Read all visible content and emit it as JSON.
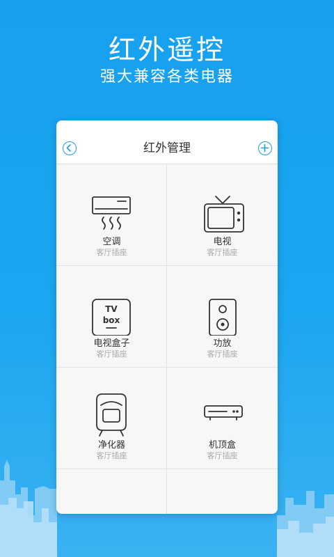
{
  "hero": {
    "title": "红外遥控",
    "subtitle": "强大兼容各类电器"
  },
  "header": {
    "title": "红外管理",
    "back_icon": "chevron-left-icon",
    "add_icon": "plus-icon"
  },
  "devices": [
    {
      "name": "空调",
      "location": "客厅插座",
      "icon": "air-conditioner-icon"
    },
    {
      "name": "电视",
      "location": "客厅插座",
      "icon": "tv-icon"
    },
    {
      "name": "电视盒子",
      "location": "客厅插座",
      "icon": "tv-box-icon",
      "icon_text": [
        "TV",
        "box"
      ]
    },
    {
      "name": "功放",
      "location": "客厅插座",
      "icon": "speaker-icon"
    },
    {
      "name": "净化器",
      "location": "客厅插座",
      "icon": "air-purifier-icon"
    },
    {
      "name": "机顶盒",
      "location": "客厅插座",
      "icon": "set-top-box-icon"
    }
  ],
  "colors": {
    "background": "#1aa6f0",
    "accent": "#1a9ee9",
    "card": "#f7f7f7"
  }
}
